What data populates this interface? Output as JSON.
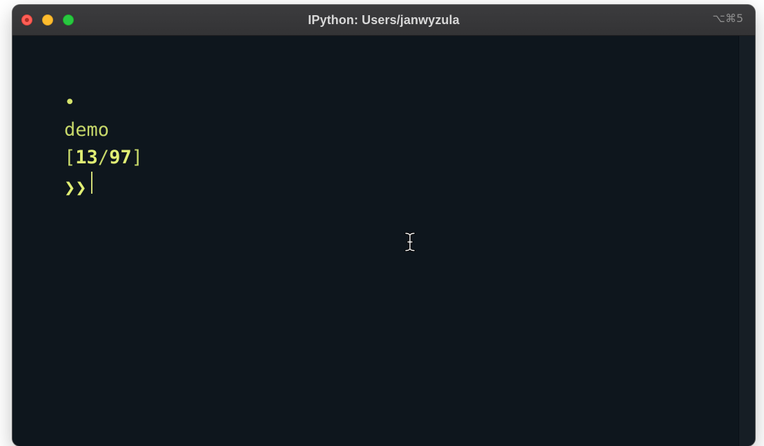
{
  "window": {
    "title": "IPython: Users/janwyzula",
    "shortcut": "⌥⌘5"
  },
  "traffic_lights": {
    "close": "close-button",
    "minimize": "minimize-button",
    "zoom": "zoom-button"
  },
  "terminal": {
    "prompt": {
      "bullet": "•",
      "env_name": "demo",
      "bracket_open": "[",
      "current": "13",
      "separator": "/",
      "total": "97",
      "bracket_close": "]",
      "arrows": "❯❯"
    },
    "input_value": ""
  },
  "colors": {
    "terminal_bg": "#0e161d",
    "prompt_fg": "#c7d86a",
    "titlebar_bg": "#3a3a3c"
  },
  "icons": {
    "mouse_cursor": "ibeam-cursor-icon"
  }
}
